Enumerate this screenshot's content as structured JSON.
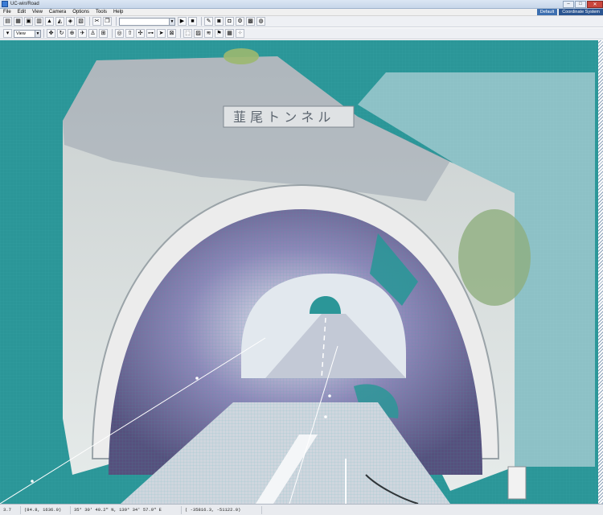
{
  "window": {
    "title": "UC-win/Road"
  },
  "menu": {
    "items": [
      "File",
      "Edit",
      "View",
      "Camera",
      "Options",
      "Tools",
      "Help"
    ],
    "mode_tabs": [
      "Default",
      "Coordinate System"
    ]
  },
  "toolbar": {
    "row1_icons": [
      "new-file-icon",
      "open-file-icon",
      "save-icon",
      "print-icon",
      "terrain-icon",
      "road-icon",
      "model-icon",
      "texture-icon",
      "cut-icon",
      "copy-icon"
    ],
    "combo_value": "",
    "row1_right_icons": [
      "play-icon",
      "stop-icon",
      "pencil-icon",
      "camera-icon",
      "car-icon",
      "settings-icon",
      "mesh-icon",
      "globe-icon"
    ],
    "view_combo": "View",
    "row2_icons": [
      "pan-icon",
      "rotate-icon",
      "zoom-icon",
      "fly-icon",
      "walk-icon",
      "measure-icon",
      "target-icon",
      "arrow-up-icon",
      "arrows-icon",
      "gamepad-icon",
      "plane-icon",
      "lock-icon",
      "select-icon",
      "render-icon",
      "fog-icon",
      "flag-icon",
      "grid-icon",
      "pointcloud-icon"
    ]
  },
  "status": {
    "fps": "3.7 fps",
    "position": "(84.8, 1636.0)",
    "coords": "35°  30' 40.2\" N, 139°  34' 57.9\" E",
    "extent": "( -35816.3, -51122.0)"
  },
  "colors": {
    "background": "#2b9698",
    "titlebar": "#c7d6ea",
    "accent": "#3d6fb0"
  }
}
